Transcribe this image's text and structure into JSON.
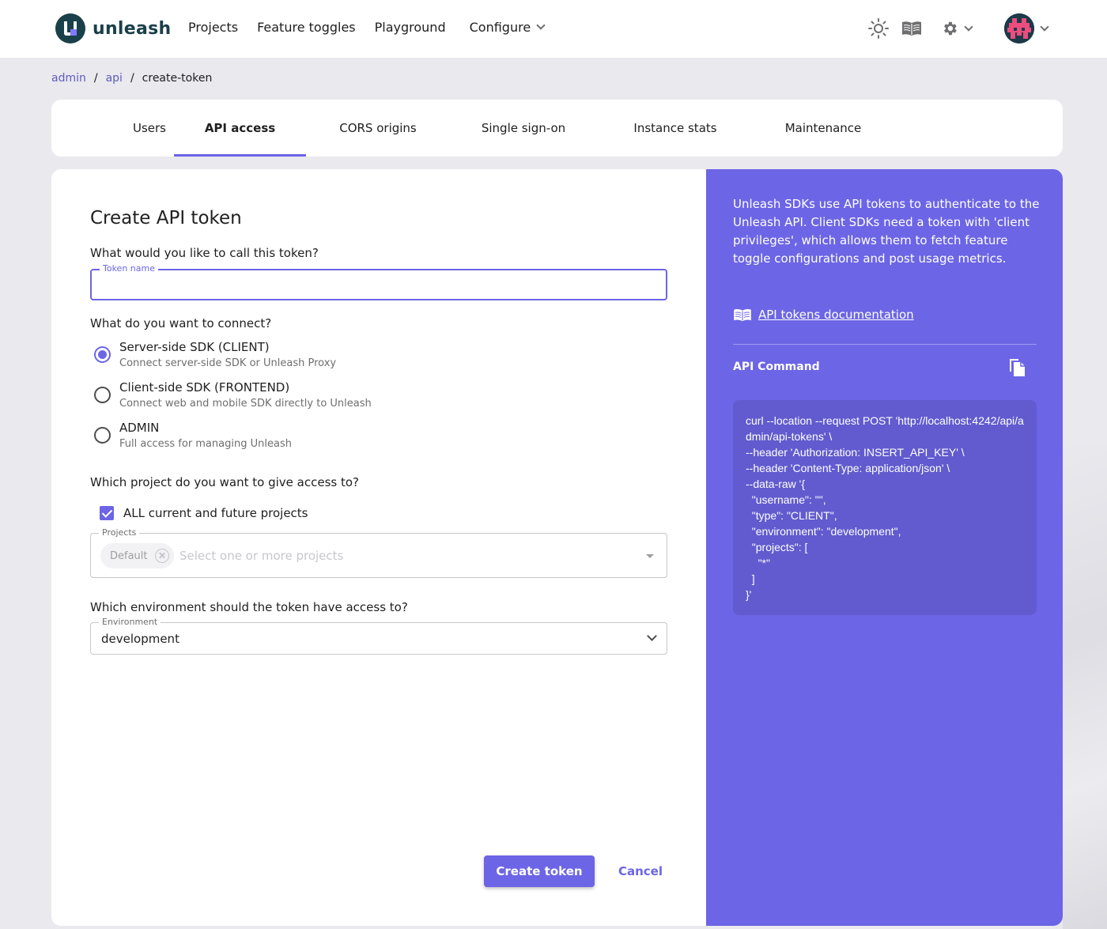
{
  "app": {
    "logo_text": "unleash",
    "nav": [
      "Projects",
      "Feature toggles",
      "Playground"
    ],
    "configure_label": "Configure"
  },
  "icons": {
    "theme": "sun-icon",
    "docs": "book-icon",
    "settings": "gear-icon",
    "profile": "avatar",
    "copy": "copy-icon"
  },
  "breadcrumb": {
    "items": [
      "admin",
      "api",
      "create-token"
    ],
    "separator": "/"
  },
  "tabs": [
    {
      "label": "Users",
      "active": false
    },
    {
      "label": "API access",
      "active": true
    },
    {
      "label": "CORS origins",
      "active": false
    },
    {
      "label": "Single sign-on",
      "active": false
    },
    {
      "label": "Instance stats",
      "active": false
    },
    {
      "label": "Maintenance",
      "active": false
    }
  ],
  "form": {
    "title": "Create API token",
    "name_question": "What would you like to call this token?",
    "name_label": "Token name",
    "name_value": "",
    "connect_question": "What do you want to connect?",
    "token_types": [
      {
        "label": "Server-side SDK (CLIENT)",
        "desc": "Connect server-side SDK or Unleash Proxy",
        "checked": true
      },
      {
        "label": "Client-side SDK (FRONTEND)",
        "desc": "Connect web and mobile SDK directly to Unleash",
        "checked": false
      },
      {
        "label": "ADMIN",
        "desc": "Full access for managing Unleash",
        "checked": false
      }
    ],
    "project_question": "Which project do you want to give access to?",
    "all_projects_label": "ALL current and future projects",
    "projects_label": "Projects",
    "project_chip": "Default",
    "projects_placeholder": "Select one or more projects",
    "env_question": "Which environment should the token have access to?",
    "env_label": "Environment",
    "env_value": "development",
    "create_button": "Create token",
    "cancel_button": "Cancel"
  },
  "sidebar": {
    "description": "Unleash SDKs use API tokens to authenticate to the Unleash API. Client SDKs need a token with 'client privileges', which allows them to fetch feature toggle configurations and post usage metrics.",
    "doc_link": "API tokens documentation",
    "command_title": "API Command",
    "command": "curl --location --request POST 'http://localhost:4242/api/admin/api-tokens' \\\n--header 'Authorization: INSERT_API_KEY' \\\n--header 'Content-Type: application/json' \\\n--data-raw '{\n  \"username\": \"\",\n  \"type\": \"CLIENT\",\n  \"environment\": \"development\",\n  \"projects\": [\n    \"*\"\n  ]\n}'"
  },
  "colors": {
    "primary": "#6c65e5",
    "logo": "#1a4049",
    "link": "#615bc2"
  }
}
